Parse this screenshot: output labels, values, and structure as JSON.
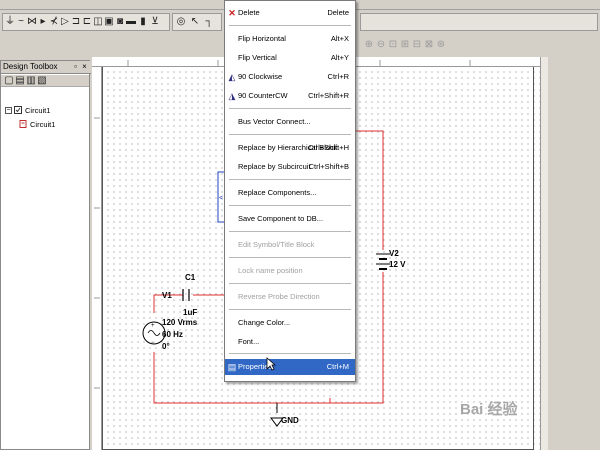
{
  "design_toolbox": {
    "title": "Design Toolbox",
    "tree": [
      {
        "label": "Circuit1",
        "level": 0
      },
      {
        "label": "Circuit1",
        "level": 1
      }
    ]
  },
  "context_menu": {
    "items": [
      {
        "label": "Delete",
        "shortcut": "Delete",
        "icon": "delete-x-icon",
        "enabled": true
      },
      {
        "label": "Flip Horizontal",
        "shortcut": "Alt+X",
        "enabled": true
      },
      {
        "label": "Flip Vertical",
        "shortcut": "Alt+Y",
        "enabled": true
      },
      {
        "label": "90 Clockwise",
        "shortcut": "Ctrl+R",
        "icon": "rotate-cw-icon",
        "enabled": true
      },
      {
        "label": "90 CounterCW",
        "shortcut": "Ctrl+Shift+R",
        "icon": "rotate-ccw-icon",
        "enabled": true
      },
      {
        "label": "Bus Vector Connect...",
        "shortcut": "",
        "enabled": true
      },
      {
        "label": "Replace by Hierarchical Block",
        "shortcut": "Ctrl+Shift+H",
        "enabled": true
      },
      {
        "label": "Replace by Subcircuit",
        "shortcut": "Ctrl+Shift+B",
        "enabled": true
      },
      {
        "label": "Replace Components...",
        "shortcut": "",
        "enabled": true
      },
      {
        "label": "Save Component to DB...",
        "shortcut": "",
        "enabled": true
      },
      {
        "label": "Edit Symbol/Title Block",
        "shortcut": "",
        "enabled": false
      },
      {
        "label": "Lock name position",
        "shortcut": "",
        "enabled": false
      },
      {
        "label": "Reverse Probe Direction",
        "shortcut": "",
        "enabled": false
      },
      {
        "label": "Change Color...",
        "shortcut": "",
        "enabled": true
      },
      {
        "label": "Font...",
        "shortcut": "",
        "enabled": true
      },
      {
        "label": "Properties",
        "shortcut": "Ctrl+M",
        "icon": "properties-icon",
        "enabled": true,
        "highlighted": true
      }
    ]
  },
  "schematic": {
    "c1_name": "C1",
    "c1_value": "1uF",
    "v1_name": "V1",
    "v1_line1": "120 Vrms",
    "v1_line2": "60 Hz",
    "v1_line3": "0°",
    "v2_name": "V2",
    "v2_value": "12 V",
    "gnd_label": "GND"
  },
  "watermark": "Bai 经验",
  "colors": {
    "wire": "#e03030",
    "selection_blue": "#2040c0",
    "menu_highlight": "#3168c6"
  }
}
